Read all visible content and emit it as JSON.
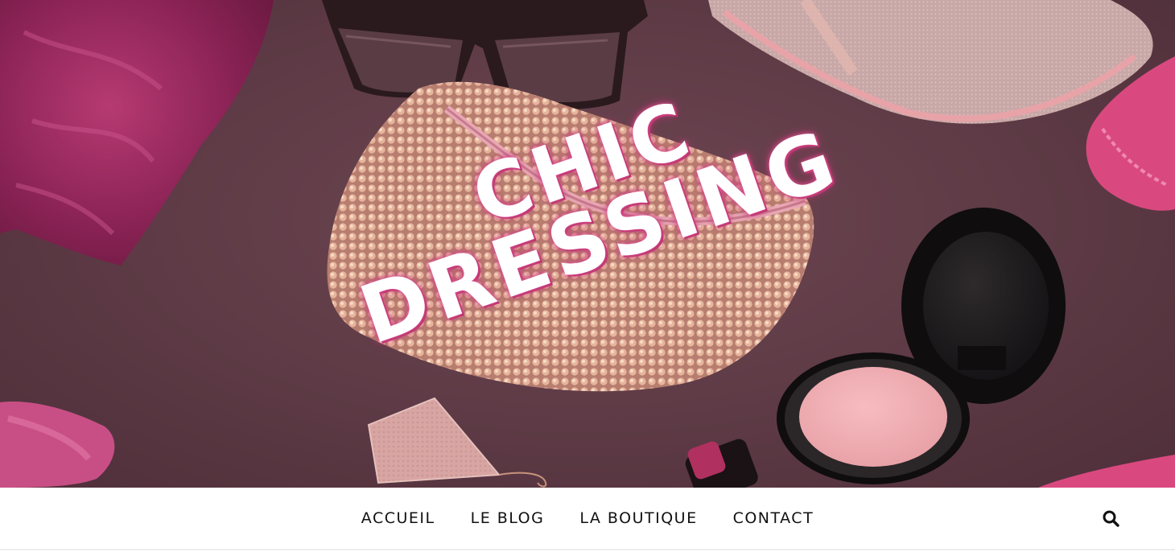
{
  "header": {
    "title_line1": "CHIC",
    "title_line2": "DRESSING"
  },
  "nav": {
    "items": [
      {
        "label": "ACCUEIL"
      },
      {
        "label": "LE BLOG"
      },
      {
        "label": "LA BOUTIQUE"
      },
      {
        "label": "CONTACT"
      }
    ],
    "search_icon": "search-icon"
  },
  "colors": {
    "hero_background": "#5d3a45",
    "accent_pink": "#d9497f",
    "title_text": "#ffffff",
    "nav_text": "#111111",
    "nav_background": "#ffffff"
  }
}
